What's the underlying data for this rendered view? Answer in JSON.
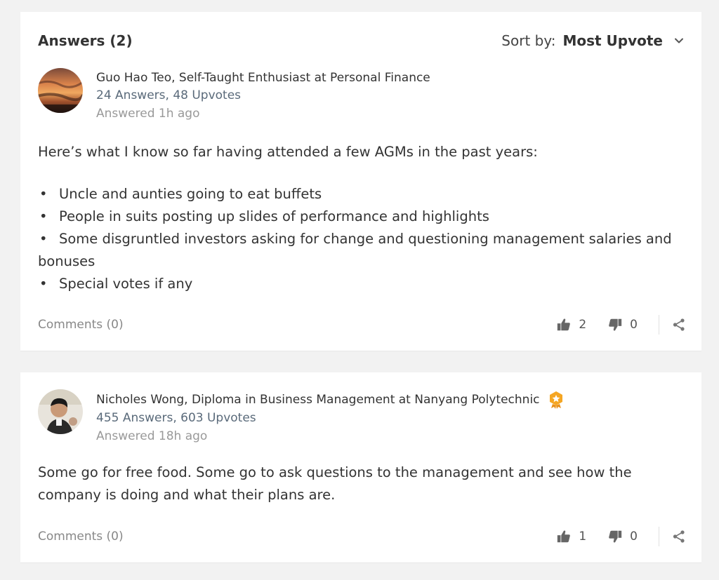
{
  "header": {
    "title": "Answers (2)",
    "sort_label": "Sort by:",
    "sort_value": "Most Upvote"
  },
  "answers": [
    {
      "author": "Guo Hao Teo, Self-Taught Enthusiast at Personal Finance",
      "stats": "24 Answers, 48 Upvotes",
      "time": "Answered 1h ago",
      "intro": "Here’s what I know so far having attended a few AGMs in the past years:",
      "bullets": [
        "Uncle and aunties going to eat buffets",
        "People in suits posting up slides of performance and highlights",
        "Some disgruntled investors asking for change and questioning management salaries and bonuses",
        "Special votes if any"
      ],
      "comments": "Comments (0)",
      "upvotes": "2",
      "downvotes": "0"
    },
    {
      "author": "Nicholes Wong, Diploma in Business Management at Nanyang Polytechnic",
      "stats": "455 Answers, 603 Upvotes",
      "time": "Answered 18h ago",
      "text": "Some go for free food. Some go to ask questions to the management and see how the company is doing and what their plans are.",
      "comments": "Comments (0)",
      "upvotes": "1",
      "downvotes": "0"
    }
  ],
  "icons": {
    "sort": "chevron-down-icon",
    "upvote": "thumbs-up-icon",
    "downvote": "thumbs-down-icon",
    "share": "share-icon",
    "badge": "star-badge-icon"
  },
  "colors": {
    "background": "#f2f2f2",
    "card": "#ffffff",
    "stats": "#5a6a7a",
    "muted": "#999999",
    "badge": "#f5a623"
  }
}
